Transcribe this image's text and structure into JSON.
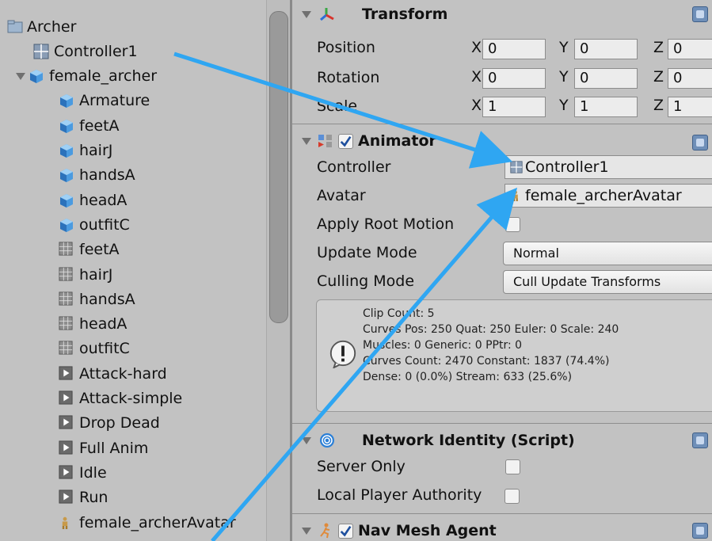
{
  "hierarchy": {
    "items": [
      {
        "label": "Archer",
        "icon": "folder-icon"
      },
      {
        "label": "Controller1",
        "icon": "animator-controller-icon"
      },
      {
        "label": "female_archer",
        "icon": "model-prefab-icon"
      },
      {
        "label": "Armature",
        "icon": "mesh-cube-icon"
      },
      {
        "label": "feetA",
        "icon": "mesh-cube-icon"
      },
      {
        "label": "hairJ",
        "icon": "mesh-cube-icon"
      },
      {
        "label": "handsA",
        "icon": "mesh-cube-icon"
      },
      {
        "label": "headA",
        "icon": "mesh-cube-icon"
      },
      {
        "label": "outfitC",
        "icon": "mesh-cube-icon"
      },
      {
        "label": "feetA",
        "icon": "mesh-grid-icon"
      },
      {
        "label": "hairJ",
        "icon": "mesh-grid-icon"
      },
      {
        "label": "handsA",
        "icon": "mesh-grid-icon"
      },
      {
        "label": "headA",
        "icon": "mesh-grid-icon"
      },
      {
        "label": "outfitC",
        "icon": "mesh-grid-icon"
      },
      {
        "label": "Attack-hard",
        "icon": "animation-clip-icon"
      },
      {
        "label": "Attack-simple",
        "icon": "animation-clip-icon"
      },
      {
        "label": "Drop Dead",
        "icon": "animation-clip-icon"
      },
      {
        "label": "Full Anim",
        "icon": "animation-clip-icon"
      },
      {
        "label": "Idle",
        "icon": "animation-clip-icon"
      },
      {
        "label": "Run",
        "icon": "animation-clip-icon"
      },
      {
        "label": "female_archerAvatar",
        "icon": "avatar-icon"
      }
    ]
  },
  "inspector": {
    "transform": {
      "title": "Transform",
      "icon": "transform-axes-icon",
      "position_label": "Position",
      "rotation_label": "Rotation",
      "scale_label": "Scale",
      "axis_x": "X",
      "axis_y": "Y",
      "axis_z": "Z",
      "position": {
        "x": "0",
        "y": "0",
        "z": "0"
      },
      "rotation": {
        "x": "0",
        "y": "0",
        "z": "0"
      },
      "scale": {
        "x": "1",
        "y": "1",
        "z": "1"
      }
    },
    "animator": {
      "title": "Animator",
      "icon": "animator-icon",
      "enabled": true,
      "controller_label": "Controller",
      "controller_value": "Controller1",
      "avatar_label": "Avatar",
      "avatar_value": "female_archerAvatar",
      "apply_root_motion_label": "Apply Root Motion",
      "apply_root_motion": false,
      "update_mode_label": "Update Mode",
      "update_mode_value": "Normal",
      "culling_mode_label": "Culling Mode",
      "culling_mode_value": "Cull Update Transforms",
      "info_icon": "info-exclamation-icon",
      "info_lines": [
        "Clip Count: 5",
        "Curves Pos: 250 Quat: 250 Euler: 0 Scale: 240",
        "Muscles: 0 Generic: 0 PPtr: 0",
        "Curves Count: 2470 Constant: 1837 (74.4%)",
        "Dense: 0 (0.0%) Stream: 633 (25.6%)"
      ]
    },
    "network_identity": {
      "title": "Network Identity (Script)",
      "icon": "network-fingerprint-icon",
      "server_only_label": "Server Only",
      "server_only": false,
      "local_player_authority_label": "Local Player Authority",
      "local_player_authority": false
    },
    "nav_mesh_agent": {
      "title": "Nav Mesh Agent",
      "icon": "nav-mesh-agent-icon",
      "enabled": true
    }
  },
  "colors": {
    "arrow": "#2fa6f2",
    "panel_bg": "#c2c2c2",
    "field_bg": "#ececec"
  }
}
